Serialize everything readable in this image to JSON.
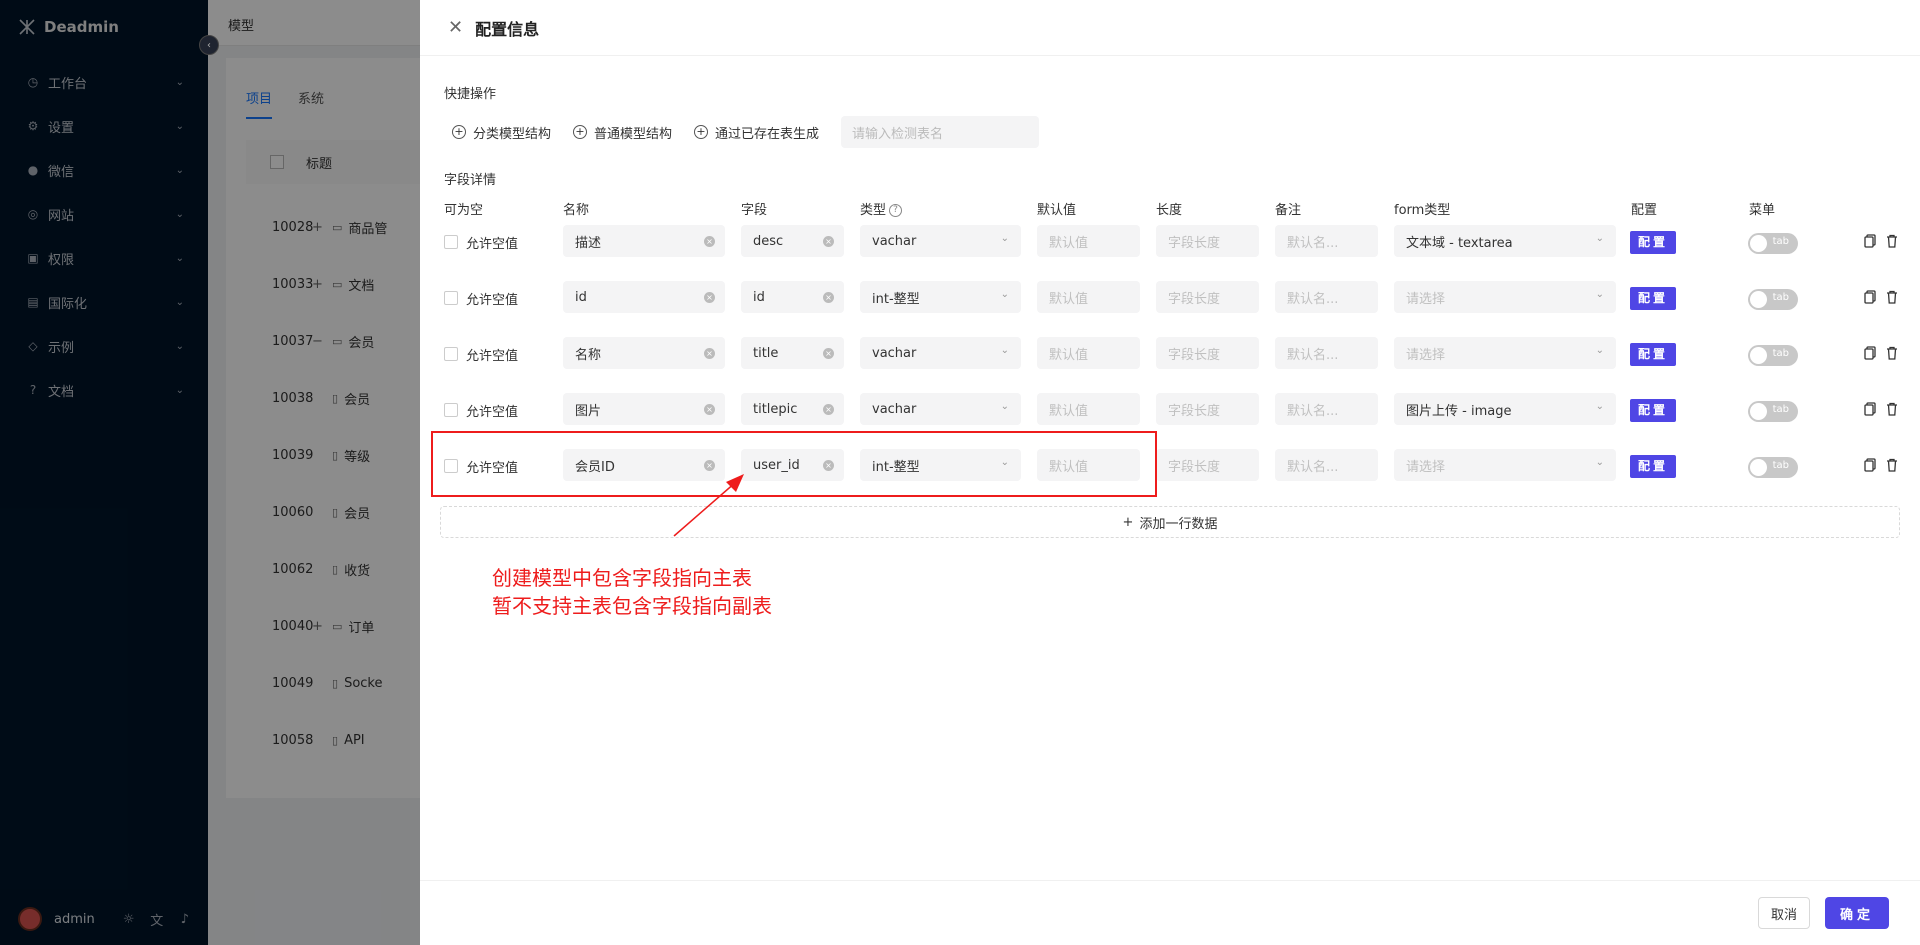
{
  "app": {
    "brand": "Deadmin"
  },
  "sidebar": {
    "items": [
      {
        "label": "工作台",
        "icon": "clock-icon"
      },
      {
        "label": "设置",
        "icon": "gear-icon"
      },
      {
        "label": "微信",
        "icon": "wechat-icon"
      },
      {
        "label": "网站",
        "icon": "globe-icon"
      },
      {
        "label": "权限",
        "icon": "lock-icon"
      },
      {
        "label": "国际化",
        "icon": "translate-icon"
      },
      {
        "label": "示例",
        "icon": "tag-icon"
      },
      {
        "label": "文档",
        "icon": "help-icon"
      }
    ],
    "user": "admin"
  },
  "background": {
    "breadcrumb": "模型",
    "tabs": [
      "项目",
      "系统"
    ],
    "header_title": "标题",
    "watermark": "Deadmin",
    "rows": [
      {
        "id": "10028",
        "name": "商品管",
        "expand": "+",
        "icon": "folder"
      },
      {
        "id": "10033",
        "name": "文档",
        "expand": "+",
        "icon": "folder"
      },
      {
        "id": "10037",
        "name": "会员",
        "expand": "−",
        "icon": "folder"
      },
      {
        "id": "10038",
        "name": "会员",
        "expand": "",
        "icon": "file"
      },
      {
        "id": "10039",
        "name": "等级",
        "expand": "",
        "icon": "file"
      },
      {
        "id": "10060",
        "name": "会员",
        "expand": "",
        "icon": "file"
      },
      {
        "id": "10062",
        "name": "收货",
        "expand": "",
        "icon": "file"
      },
      {
        "id": "10040",
        "name": "订单",
        "expand": "+",
        "icon": "folder"
      },
      {
        "id": "10049",
        "name": "Socke",
        "expand": "",
        "icon": "file"
      },
      {
        "id": "10058",
        "name": "API",
        "expand": "",
        "icon": "file"
      }
    ]
  },
  "drawer": {
    "title": "配置信息",
    "quick_label": "快捷操作",
    "quick_buttons": [
      "分类模型结构",
      "普通模型结构",
      "通过已存在表生成"
    ],
    "quick_input_placeholder": "请输入检测表名",
    "fields_label": "字段详情",
    "columns": [
      "可为空",
      "名称",
      "字段",
      "类型",
      "默认值",
      "长度",
      "备注",
      "form类型",
      "配置",
      "菜单"
    ],
    "allow_null_label": "允许空值",
    "placeholders": {
      "default": "默认值",
      "length": "字段长度",
      "remark": "默认名...",
      "form": "请选择"
    },
    "config_label": "配置",
    "toggle_label": "tab",
    "rows": [
      {
        "name": "描述",
        "field": "desc",
        "type": "vachar",
        "form": "文本域 - textarea"
      },
      {
        "name": "id",
        "field": "id",
        "type": "int-整型",
        "form": ""
      },
      {
        "name": "名称",
        "field": "title",
        "type": "vachar",
        "form": ""
      },
      {
        "name": "图片",
        "field": "titlepic",
        "type": "vachar",
        "form": "图片上传 - image"
      },
      {
        "name": "会员ID",
        "field": "user_id",
        "type": "int-整型",
        "form": ""
      }
    ],
    "add_row_label": "添加一行数据",
    "annotation": [
      "创建模型中包含字段指向主表",
      "暂不支持主表包含字段指向副表"
    ],
    "cancel_label": "取消",
    "ok_label": "确定"
  },
  "colors": {
    "accent": "#4f46e5",
    "annotation": "#ee1c1c",
    "sidebar_bg": "#001529"
  }
}
